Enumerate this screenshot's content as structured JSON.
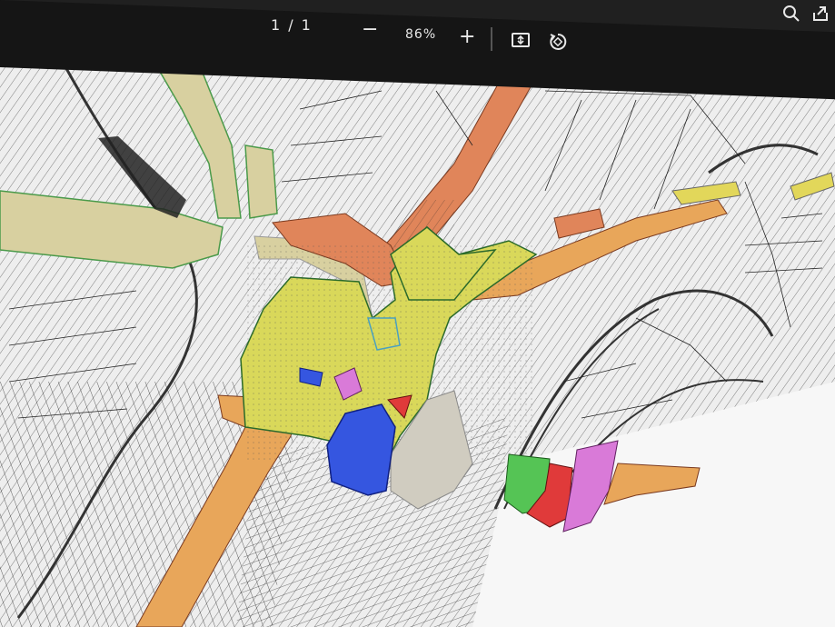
{
  "viewer": {
    "page_current": "1",
    "page_separator": "/",
    "page_total": "1",
    "zoom_out_symbol": "−",
    "zoom_level": "86%",
    "zoom_in_symbol": "+",
    "icons": [
      "fit-page-icon",
      "rotate-icon",
      "search-icon",
      "share-icon"
    ]
  },
  "map": {
    "description_colors": {
      "residential_yellow": "#d9d85a",
      "village_core_orange": "#e0855a",
      "public_blue": "#3556e0",
      "green_space": "#55c455",
      "special_red": "#e03a3a",
      "special_pink": "#d97ad8",
      "light_orange": "#e8a65a",
      "beige": "#d8d0a0",
      "parcel_line": "#111111",
      "paper": "#f4f4f4"
    }
  }
}
